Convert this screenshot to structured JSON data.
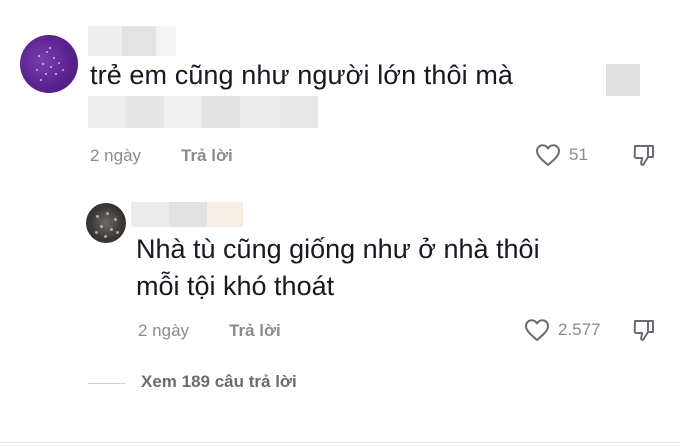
{
  "comments": [
    {
      "text": "trẻ em cũng như người lớn thôi mà",
      "time": "2 ngày",
      "reply_label": "Trả lời",
      "likes": "51"
    },
    {
      "text_line1": "Nhà tù cũng giống như ở nhà thôi",
      "text_line2": "mỗi tội khó thoát",
      "time": "2 ngày",
      "reply_label": "Trả lời",
      "likes": "2.577"
    }
  ],
  "view_more": "Xem 189 câu trả lời",
  "icons": {
    "like": "heart-outline-icon",
    "dislike": "thumbs-down-icon"
  },
  "colors": {
    "text": "#161823",
    "muted": "#8a8b91",
    "avatar1": "#5b2290"
  }
}
